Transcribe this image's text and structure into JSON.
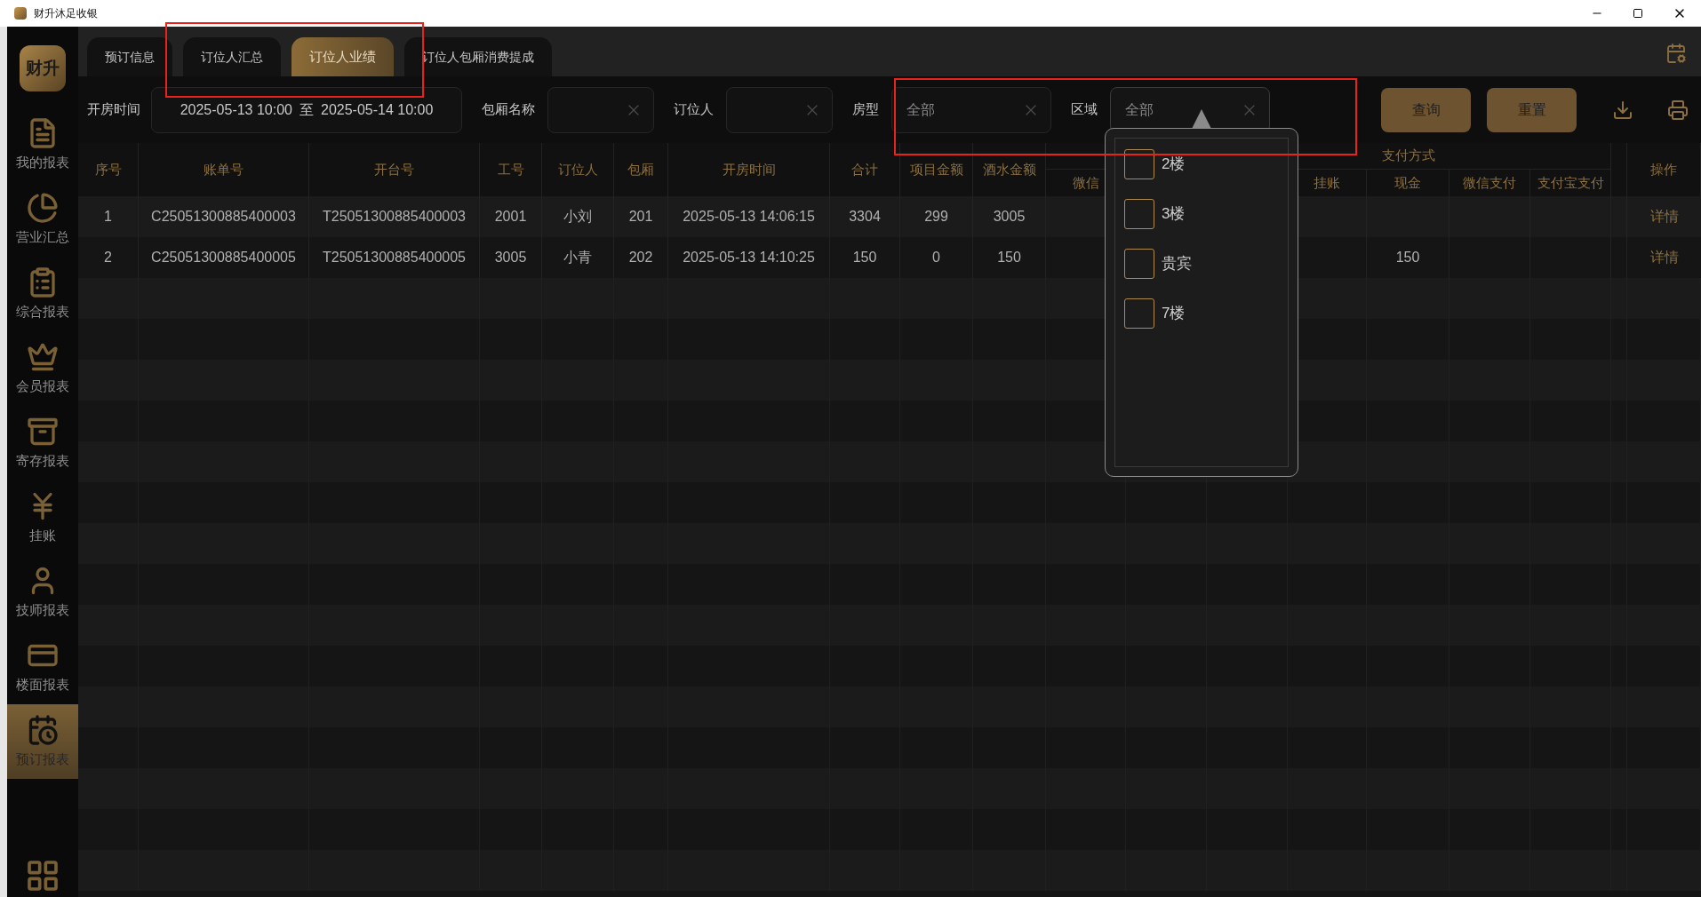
{
  "window": {
    "title": "财升沐足收银"
  },
  "sidebar": {
    "logo": "财升",
    "items": [
      {
        "label": "我的报表",
        "selected": false
      },
      {
        "label": "营业汇总",
        "selected": false
      },
      {
        "label": "综合报表",
        "selected": false
      },
      {
        "label": "会员报表",
        "selected": false
      },
      {
        "label": "寄存报表",
        "selected": false
      },
      {
        "label": "挂账",
        "selected": false
      },
      {
        "label": "技师报表",
        "selected": false
      },
      {
        "label": "楼面报表",
        "selected": false
      },
      {
        "label": "预订报表",
        "selected": true
      }
    ]
  },
  "tabs": [
    {
      "label": "预订信息",
      "selected": false
    },
    {
      "label": "订位人汇总",
      "selected": false
    },
    {
      "label": "订位人业绩",
      "selected": true
    },
    {
      "label": "订位人包厢消费提成",
      "selected": false
    }
  ],
  "filters": {
    "open_time": {
      "label": "开房时间",
      "start": "2025-05-13 10:00",
      "separator": "至",
      "end": "2025-05-14 10:00"
    },
    "room_name": {
      "label": "包厢名称"
    },
    "booker": {
      "label": "订位人"
    },
    "room_type": {
      "label": "房型",
      "value": "全部"
    },
    "area": {
      "label": "区域",
      "value": "全部",
      "expanded": true
    }
  },
  "buttons": [
    "查询",
    "重置"
  ],
  "table": {
    "columns": [
      "序号",
      "账单号",
      "开台号",
      "工号",
      "订位人",
      "包厢",
      "开房时间",
      "合计",
      "项目金额",
      "酒水金额"
    ],
    "wechat_column": "微信",
    "payment_group": {
      "label": "支付方式",
      "columns": [
        "挂账",
        "现金",
        "微信支付",
        "支付宝支付"
      ]
    },
    "action_column": "操作",
    "rows": [
      {
        "no": "1",
        "bill": "C25051300885400003",
        "table_no": "T25051300885400003",
        "staff_id": "2001",
        "booker": "小刘",
        "room": "201",
        "open_time": "2025-05-13 14:06:15",
        "total": "3304",
        "item_amount": "299",
        "drink_amount": "3005",
        "action": "详情"
      },
      {
        "no": "2",
        "bill": "C25051300885400005",
        "table_no": "T25051300885400005",
        "staff_id": "3005",
        "booker": "小青",
        "room": "202",
        "open_time": "2025-05-13 14:10:25",
        "total": "150",
        "item_amount": "0",
        "drink_amount": "150",
        "cash": "150",
        "action": "详情"
      }
    ]
  },
  "area_dropdown": {
    "options": [
      {
        "label": "2楼",
        "checked": false
      },
      {
        "label": "3楼",
        "checked": false
      },
      {
        "label": "贵宾",
        "checked": false
      },
      {
        "label": "7楼",
        "checked": false
      }
    ]
  }
}
